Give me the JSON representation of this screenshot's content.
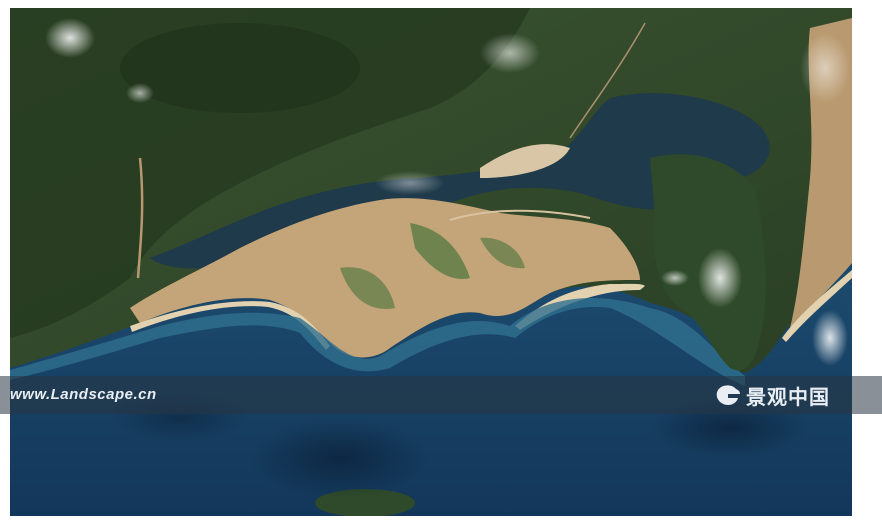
{
  "image": {
    "kind": "satellite-photo",
    "watermark": {
      "url_text": "www.Landscape.cn",
      "logo_text": "景观中国",
      "logo_icon": "landscape-china-logo-icon"
    },
    "colors": {
      "sea_deep": "#173f5e",
      "sea_shallow": "#2f6f8e",
      "forest": "#2d4227",
      "sand": "#c9a67a",
      "band": "#283442"
    }
  }
}
